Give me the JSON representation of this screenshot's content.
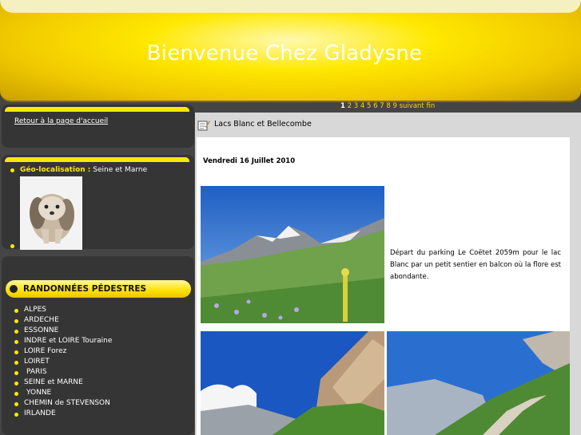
{
  "header": {
    "title": "Bienvenue Chez Gladysne"
  },
  "sidebar": {
    "home_link": "Retour à la page d'accueil",
    "geo": {
      "label": "Géo-localisation :",
      "value": "Seine et Marne"
    },
    "rando": {
      "title": "RANDONNÉES PÉDESTRES",
      "items": [
        "ALPES",
        "ARDECHE",
        "ESSONNE",
        "INDRE et LOIRE Touraine",
        "LOIRE Forez",
        "LOIRET",
        "PARIS",
        "SEINE et MARNE",
        "YONNE",
        "CHEMIN de STEVENSON",
        "IRLANDE"
      ]
    }
  },
  "pager": {
    "current": "1",
    "pages": [
      "2",
      "3",
      "4",
      "5",
      "6",
      "7",
      "8",
      "9"
    ],
    "next": "suivant",
    "last": "fin"
  },
  "article": {
    "title": "Lacs Blanc et Bellecombe",
    "date": "Vendredi 16 Juillet 2010",
    "text": "Départ du parking Le Coëtet 2059m pour le lac Blanc par un petit sentier en balcon où la flore est abondante."
  },
  "colors": {
    "accent": "#ffe800",
    "panel": "#353535",
    "background": "#454545"
  },
  "icons": {
    "article": "notepad-icon",
    "bullet": "yellow-dot-icon"
  }
}
